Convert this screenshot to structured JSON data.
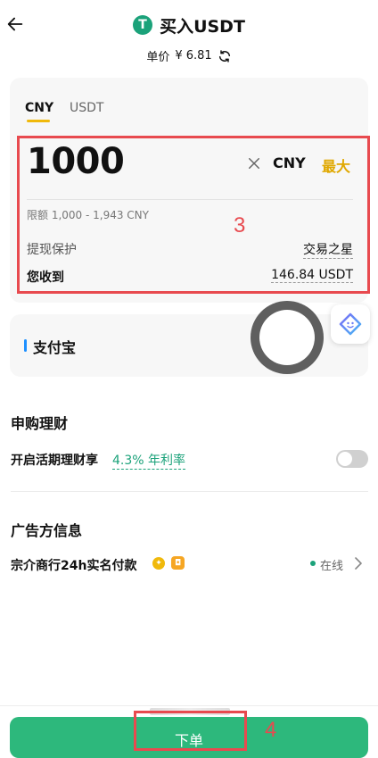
{
  "header": {
    "title": "买入USDT",
    "back_icon": "arrow-left-icon",
    "token_icon_glyph": "T",
    "token_icon_color": "#1ba27a"
  },
  "price": {
    "label": "单价",
    "value": "¥ 6.81",
    "refresh_icon": "refresh-icon"
  },
  "tabs": [
    {
      "label": "CNY",
      "active": true
    },
    {
      "label": "USDT",
      "active": false
    }
  ],
  "amount": {
    "value": "1000",
    "unit": "CNY",
    "max_label": "最大",
    "clear_icon": "close-icon"
  },
  "limit": {
    "text": "限额 1,000 - 1,943 CNY"
  },
  "protection": {
    "label": "提现保护",
    "value": "交易之星"
  },
  "receive": {
    "label": "您收到",
    "value": "146.84 USDT"
  },
  "payment": {
    "method": "支付宝",
    "bar_color": "#1e90ff"
  },
  "subscription": {
    "title": "申购理财",
    "earn_label": "开启活期理财享",
    "earn_rate": "4.3% 年利率",
    "toggle_on": false
  },
  "advertiser": {
    "title": "广告方信息",
    "name": "宗介商行24h实名付款",
    "status": "在线"
  },
  "footer": {
    "order_label": "下单",
    "accent": "#2db87c"
  },
  "annotations": {
    "box3_label": "3",
    "box4_label": "4",
    "color": "#e84a4f"
  }
}
